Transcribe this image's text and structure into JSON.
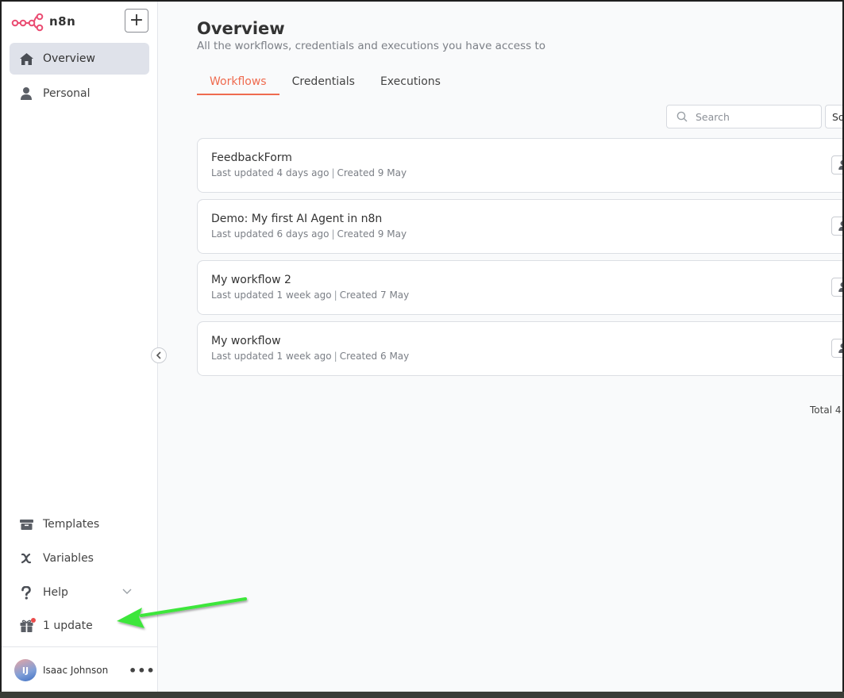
{
  "app": {
    "logo_text": "n8n",
    "accent_color": "#ef6b4f",
    "logo_color": "#ea4b71"
  },
  "sidebar": {
    "add_label": "+",
    "nav_top": [
      {
        "label": "Overview",
        "icon": "home-icon",
        "active": true
      },
      {
        "label": "Personal",
        "icon": "user-icon",
        "active": false
      }
    ],
    "nav_bottom": [
      {
        "label": "Templates",
        "icon": "box-icon"
      },
      {
        "label": "Variables",
        "icon": "variable-icon"
      },
      {
        "label": "Help",
        "icon": "question-icon"
      },
      {
        "label": "1 update",
        "icon": "gift-icon"
      }
    ],
    "user": {
      "initials": "IJ",
      "name": "Isaac Johnson",
      "menu_label": "•••"
    }
  },
  "main": {
    "title": "Overview",
    "subtitle": "All the workflows, credentials and executions you have access to",
    "tabs": [
      {
        "label": "Workflows",
        "active": true
      },
      {
        "label": "Credentials",
        "active": false
      },
      {
        "label": "Executions",
        "active": false
      }
    ],
    "search": {
      "placeholder": "Search",
      "value": ""
    },
    "sort_label": "So",
    "workflows": [
      {
        "name": "FeedbackForm",
        "updated": "Last updated 4 days ago",
        "created": "Created 9 May"
      },
      {
        "name": "Demo: My first AI Agent in n8n",
        "updated": "Last updated 6 days ago",
        "created": "Created 9 May"
      },
      {
        "name": "My workflow 2",
        "updated": "Last updated 1 week ago",
        "created": "Created 7 May"
      },
      {
        "name": "My workflow",
        "updated": "Last updated 1 week ago",
        "created": "Created 6 May"
      }
    ],
    "meta_separator": "|",
    "total_label": "Total 4"
  },
  "annotation": {
    "arrow_color": "#3ee63b"
  }
}
